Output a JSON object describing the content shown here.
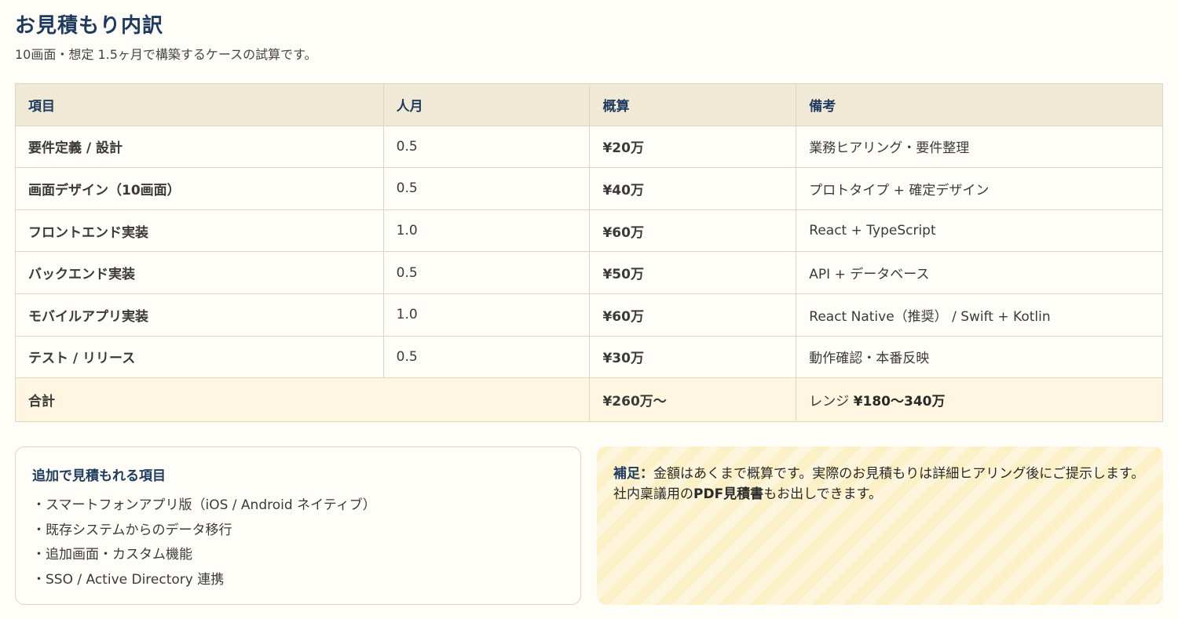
{
  "header": {
    "title": "お見積もり内訳",
    "subtitle": "10画面・想定 1.5ヶ月で構築するケースの試算です。"
  },
  "table": {
    "columns": [
      "項目",
      "人月",
      "概算",
      "備考"
    ],
    "rows": [
      {
        "item": "要件定義 / 設計",
        "months": "0.5",
        "amount": "¥20万",
        "note": "業務ヒアリング・要件整理"
      },
      {
        "item": "画面デザイン（10画面）",
        "months": "0.5",
        "amount": "¥40万",
        "note": "プロトタイプ + 確定デザイン"
      },
      {
        "item": "フロントエンド実装",
        "months": "1.0",
        "amount": "¥60万",
        "note": "React + TypeScript"
      },
      {
        "item": "バックエンド実装",
        "months": "0.5",
        "amount": "¥50万",
        "note": "API + データベース"
      },
      {
        "item": "モバイルアプリ実装",
        "months": "1.0",
        "amount": "¥60万",
        "note": "React Native（推奨） / Swift + Kotlin"
      },
      {
        "item": "テスト / リリース",
        "months": "0.5",
        "amount": "¥30万",
        "note": "動作確認・本番反映"
      }
    ],
    "total": {
      "label": "合計",
      "amount": "¥260万〜",
      "range_prefix": "レンジ ",
      "range_value": "¥180〜340万"
    }
  },
  "additional": {
    "heading": "追加で見積もれる項目",
    "items": [
      "・スマートフォンアプリ版（iOS / Android ネイティブ）",
      "・既存システムからのデータ移行",
      "・追加画面・カスタム機能",
      "・SSO / Active Directory 連携"
    ]
  },
  "note": {
    "lead": "補足：",
    "text1": "金額はあくまで概算です。実際のお見積もりは詳細ヒアリング後にご提示します。",
    "text2_pre": "社内稟議用の",
    "text2_bold": "PDF見積書",
    "text2_post": "もお出しできます。"
  },
  "colors": {
    "accent_navy": "#1e3a5f",
    "total_orange": "#e0552a",
    "header_bg": "#f0e9d6",
    "total_bg": "#fff6e2"
  }
}
